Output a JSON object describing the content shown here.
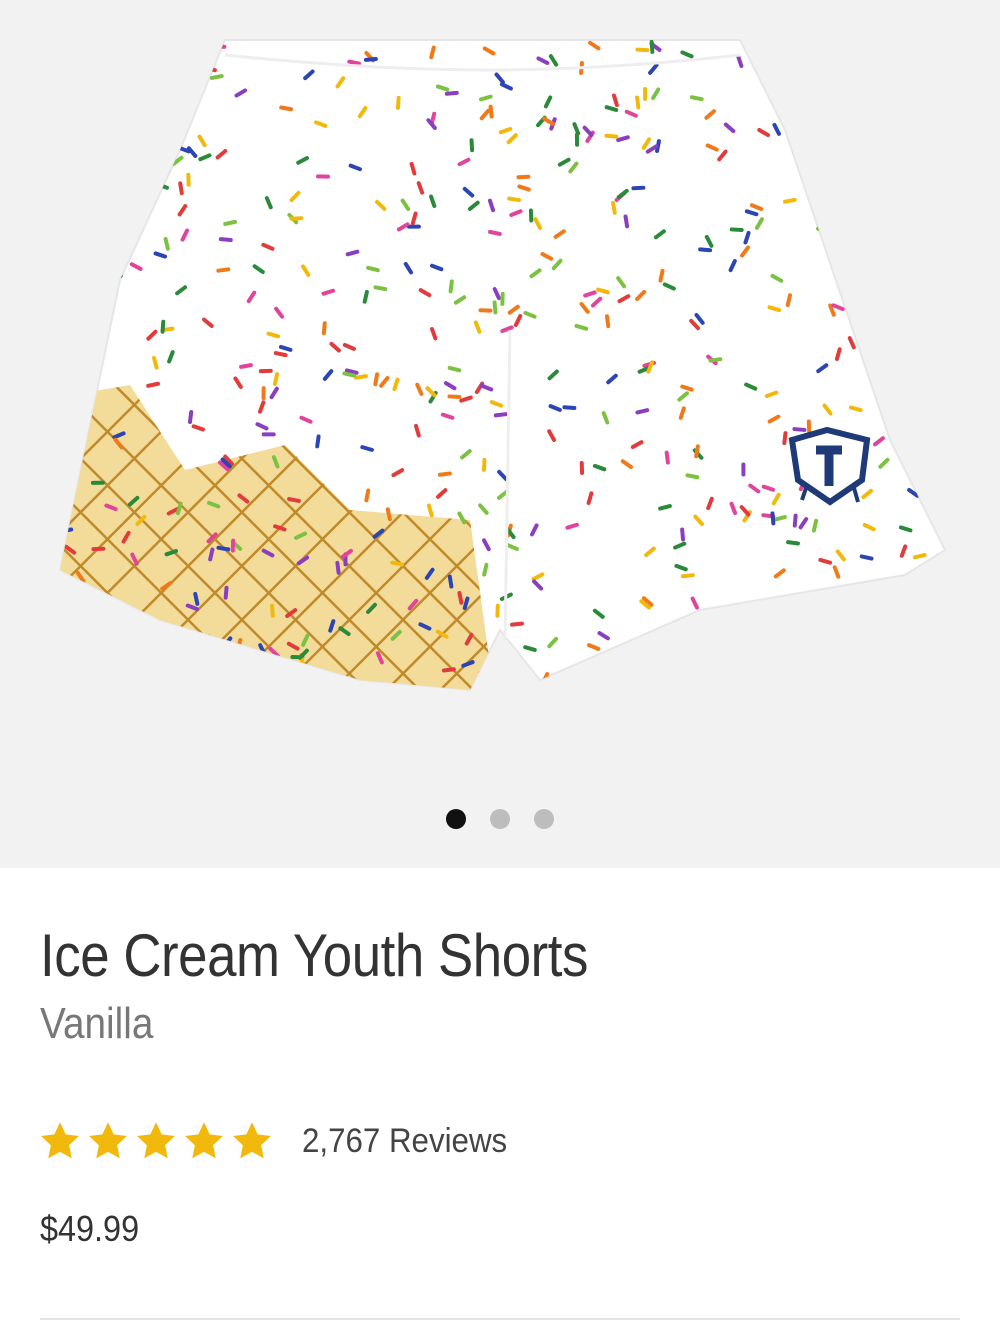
{
  "gallery": {
    "image_alt": "Ice Cream Youth Shorts",
    "slide_count": 3,
    "active_slide": 1
  },
  "product": {
    "title": "Ice Cream Youth Shorts",
    "variant": "Vanilla",
    "rating": 5,
    "max_rating": 5,
    "reviews_label": "2,767 Reviews",
    "price": "$49.99"
  },
  "colors": {
    "star": "#f2b90c",
    "active_dot": "#111111",
    "inactive_dot": "#bdbdbd",
    "gallery_bg": "#f2f2f2",
    "cone": "#f3dc9a",
    "cone_grid": "#c08a2a"
  },
  "icons": {
    "star": "star-icon",
    "logo": "shield-logo-icon"
  }
}
